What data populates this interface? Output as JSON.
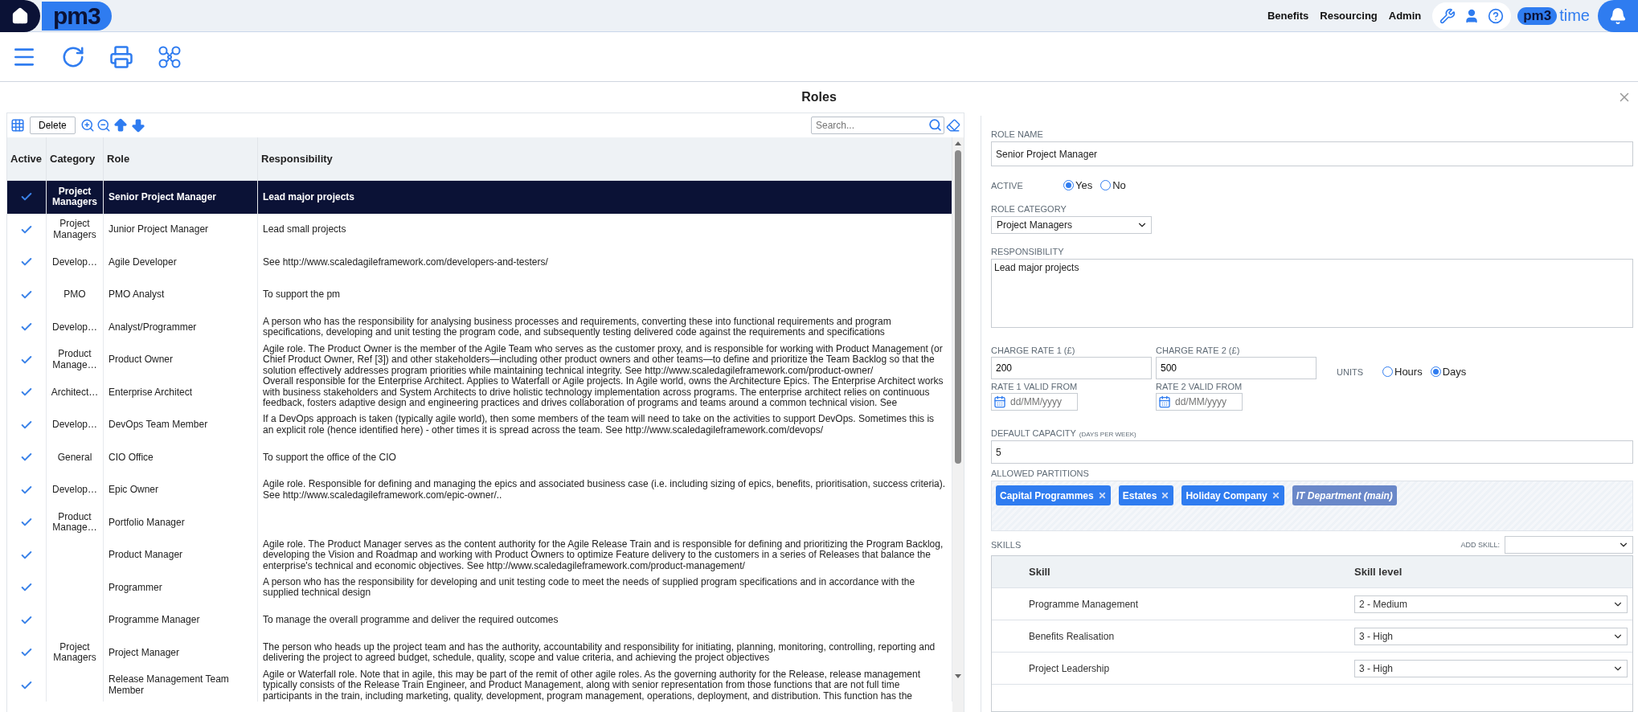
{
  "topbar": {
    "logo": "pm3",
    "links": [
      {
        "label": "Benefits"
      },
      {
        "label": "Resourcing"
      },
      {
        "label": "Admin"
      }
    ],
    "time_logo": {
      "mark": "pm3",
      "word": "time"
    }
  },
  "page_title": "Roles",
  "roles_table": {
    "delete_button": "Delete",
    "search": {
      "placeholder": "Search..."
    },
    "columns": [
      "Active",
      "Category",
      "Role",
      "Responsibility"
    ],
    "rows": [
      {
        "active": true,
        "category": "Project Managers",
        "role": "Senior Project Manager",
        "responsibility": "Lead major projects",
        "selected": true
      },
      {
        "active": true,
        "category": "Project Managers",
        "role": "Junior Project Manager",
        "responsibility": "Lead small projects",
        "selected": false
      },
      {
        "active": true,
        "category": "Develop…",
        "role": "Agile Developer",
        "responsibility": "See http://www.scaledagileframework.com/developers-and-testers/",
        "selected": false
      },
      {
        "active": true,
        "category": "PMO",
        "role": "PMO Analyst",
        "responsibility": "To support the pm",
        "selected": false
      },
      {
        "active": true,
        "category": "Develop…",
        "role": "Analyst/Programmer",
        "responsibility": "A person who has the responsibility for analysing business processes and requirements, converting these into functional requirements and program specifications, developing and unit testing the program code, and subsequently testing delivered code against the requirements and specifications",
        "selected": false
      },
      {
        "active": true,
        "category": "Product Manage…",
        "role": "Product Owner",
        "responsibility": "Agile role. The Product Owner is the member of the Agile Team who serves as the customer proxy, and is responsible for working with Product Management (or Chief Product Owner, Ref [3]) and other stakeholders—including other product owners and other teams—to define and prioritize the Team Backlog so that the solution effectively addresses program priorities while maintaining technical integrity. See http://www.scaledagileframework.com/product-owner/",
        "selected": false
      },
      {
        "active": true,
        "category": "Architect…",
        "role": "Enterprise Architect",
        "responsibility": "Overall responsible for the Enterprise Architect. Applies to Waterfall or Agile projects. In Agile world, owns the Architecture Epics. The Enterprise Architect works with business stakeholders and System Architects to drive holistic technology implementation across programs. The enterprise architect relies on continuous feedback, fosters adaptive design and engineering practices and drives collaboration of programs and teams around a common technical vision. See",
        "selected": false
      },
      {
        "active": true,
        "category": "Develop…",
        "role": "DevOps Team Member",
        "responsibility": "If a DevOps approach is taken (typically agile world), then some members of the team will need to take on the activities to support DevOps. Sometimes this is an explicit role (hence identified here) - other times it is spread across the team. See http://www.scaledagileframework.com/devops/",
        "selected": false
      },
      {
        "active": true,
        "category": "General",
        "role": "CIO Office",
        "responsibility": "To support the office of the CIO",
        "selected": false
      },
      {
        "active": true,
        "category": "Develop…",
        "role": "Epic Owner",
        "responsibility": "Agile role. Responsible for defining and managing the epics and associated business case (i.e. including sizing of epics, benefits, prioritisation, success criteria). See http://www.scaledagileframework.com/epic-owner/..",
        "selected": false
      },
      {
        "active": true,
        "category": "Product Manage…",
        "role": "Portfolio Manager",
        "selected": false
      },
      {
        "active": true,
        "role": "Product Manager",
        "responsibility": "Agile role. The Product Manager serves as the content authority for the Agile Release Train and is responsible for defining and prioritizing the Program Backlog, developing the Vision and Roadmap and working with Product Owners to optimize Feature delivery to the customers in a series of Releases that balance the enterprise's technical and economic objectives. See http://www.scaledagileframework.com/product-management/",
        "selected": false
      },
      {
        "active": true,
        "role": "Programmer",
        "responsibility": "A person who has the responsibility for developing and unit testing code to meet the needs of supplied program specifications and in accordance with the supplied technical design",
        "selected": false
      },
      {
        "active": true,
        "role": "Programme Manager",
        "responsibility": "To manage the overall programme and deliver the required outcomes",
        "selected": false
      },
      {
        "active": true,
        "category": "Project Managers",
        "role": "Project Manager",
        "responsibility": "The person who heads up the project team and has the authority, accountability and responsibility for initiating, planning, monitoring, controlling, reporting and delivering the project to agreed budget, schedule, quality, scope and value criteria, and achieving the project objectives",
        "selected": false
      },
      {
        "active": true,
        "role": "Release Management Team Member",
        "responsibility": "Agile or Waterfall role. Note that in agile, this may be part of the remit of other agile roles. As the governing authority for the Release, release management typically consists of the Release Train Engineer, and Product Management, along with senior representation from those functions that are not full time participants in the train, including marketing, quality, development, program management, operations, deployment, and distribution. This function has the",
        "selected": false
      }
    ]
  },
  "role_form": {
    "role_name": {
      "label": "ROLE NAME",
      "value": "Senior Project Manager"
    },
    "active": {
      "label": "ACTIVE",
      "options": [
        {
          "label": "Yes",
          "selected": true
        },
        {
          "label": "No",
          "selected": false
        }
      ]
    },
    "role_category": {
      "label": "ROLE CATEGORY",
      "value": "Project Managers"
    },
    "responsibility": {
      "label": "RESPONSIBILITY",
      "value": "Lead major projects"
    },
    "charge_rates": [
      {
        "label": "CHARGE RATE 1 (£)",
        "value": "200"
      },
      {
        "label": "CHARGE RATE 2 (£)",
        "value": "500"
      }
    ],
    "units": {
      "label": "UNITS",
      "options": [
        {
          "label": "Hours",
          "selected": false
        },
        {
          "label": "Days",
          "selected": true
        }
      ]
    },
    "valid_from": [
      {
        "label": "RATE 1 VALID FROM",
        "placeholder": "dd/MM/yyyy"
      },
      {
        "label": "RATE 2 VALID FROM",
        "placeholder": "dd/MM/yyyy"
      }
    ],
    "default_capacity": {
      "label": "DEFAULT CAPACITY",
      "hint": "(DAYS PER WEEK)",
      "value": "5"
    },
    "allowed_partitions": {
      "label": "ALLOWED PARTITIONS",
      "tags": [
        {
          "label": "Capital Programmes",
          "removable": true
        },
        {
          "label": "Estates",
          "removable": true
        },
        {
          "label": "Holiday Company",
          "removable": true
        },
        {
          "label": "IT Department (main)",
          "removable": false
        }
      ]
    },
    "skills": {
      "label": "SKILLS",
      "add_label": "ADD SKILL:",
      "columns": [
        "Skill",
        "Skill level"
      ],
      "rows": [
        {
          "skill": "Programme Management",
          "level": "2 - Medium"
        },
        {
          "skill": "Benefits Realisation",
          "level": "3 - High"
        },
        {
          "skill": "Project Leadership",
          "level": "3 - High"
        }
      ]
    }
  }
}
